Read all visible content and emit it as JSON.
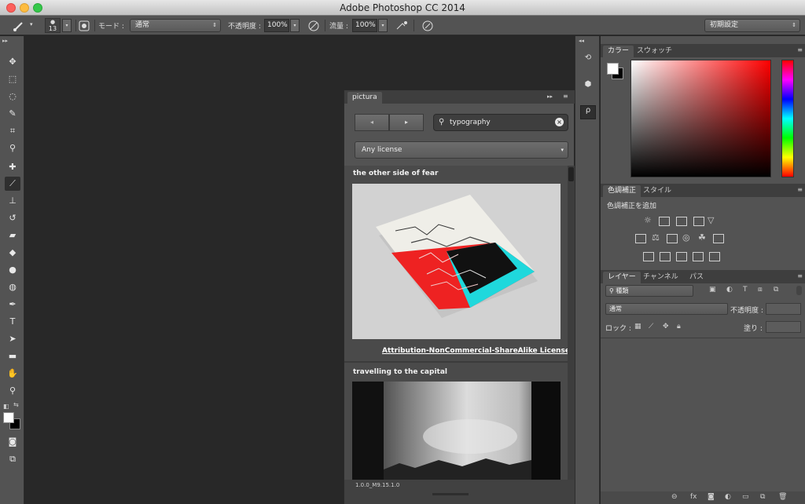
{
  "window": {
    "title": "Adobe Photoshop CC 2014"
  },
  "options_bar": {
    "brush_size": "13",
    "mode_label": "モード :",
    "mode_value": "通常",
    "opacity_label": "不透明度 :",
    "opacity_value": "100%",
    "flow_label": "流量 :",
    "flow_value": "100%",
    "workspace": "初期設定"
  },
  "pictura": {
    "tab": "pictura",
    "search": {
      "value": "typography"
    },
    "license_filter": "Any license",
    "results": [
      {
        "title": "the other side of fear",
        "license": "Attribution-NonCommercial-ShareAlike License"
      },
      {
        "title": "travelling to the capital"
      }
    ],
    "version": "1.0.0_M9.15.1.0"
  },
  "color_panel": {
    "tabs": [
      "カラー",
      "スウォッチ"
    ]
  },
  "adjustments_panel": {
    "tabs": [
      "色調補正",
      "スタイル"
    ],
    "heading": "色調補正を追加"
  },
  "layers_panel": {
    "tabs": [
      "レイヤー",
      "チャンネル",
      "パス"
    ],
    "filter": "種類",
    "blend_mode": "通常",
    "opacity_label": "不透明度 :",
    "lock_label": "ロック :",
    "fill_label": "塗り :"
  },
  "colors": {
    "ui_bg": "#535353",
    "canvas": "#282828",
    "link": "#ffffff"
  }
}
